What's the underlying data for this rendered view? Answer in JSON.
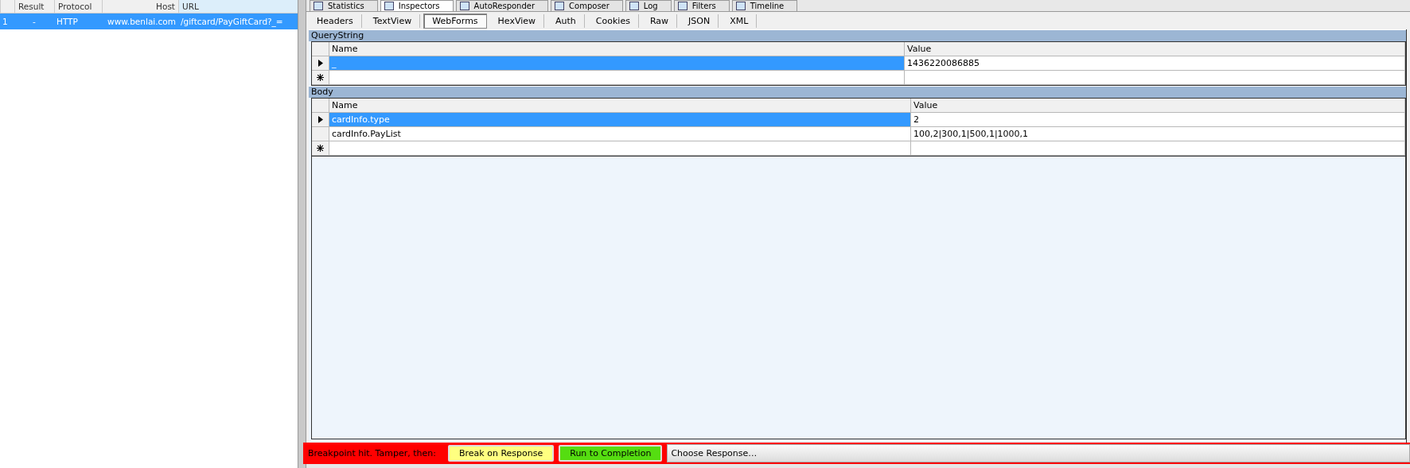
{
  "session_list": {
    "columns": [
      "Result",
      "Protocol",
      "Host",
      "URL"
    ],
    "rows": [
      {
        "number": "1",
        "result": "-",
        "protocol": "HTTP",
        "host": "www.benlai.com",
        "url": "/giftcard/PayGiftCard?_=",
        "selected": true
      }
    ]
  },
  "main_tabs": [
    {
      "label": "Statistics",
      "selected": false
    },
    {
      "label": "Inspectors",
      "selected": true
    },
    {
      "label": "AutoResponder",
      "selected": false
    },
    {
      "label": "Composer",
      "selected": false
    },
    {
      "label": "Log",
      "selected": false
    },
    {
      "label": "Filters",
      "selected": false
    },
    {
      "label": "Timeline",
      "selected": false
    }
  ],
  "inspector_tabs": [
    {
      "label": "Headers",
      "selected": false
    },
    {
      "label": "TextView",
      "selected": false
    },
    {
      "label": "WebForms",
      "selected": true
    },
    {
      "label": "HexView",
      "selected": false
    },
    {
      "label": "Auth",
      "selected": false
    },
    {
      "label": "Cookies",
      "selected": false
    },
    {
      "label": "Raw",
      "selected": false
    },
    {
      "label": "JSON",
      "selected": false
    },
    {
      "label": "XML",
      "selected": false
    }
  ],
  "query_string": {
    "title": "QueryString",
    "columns": [
      "Name",
      "Value"
    ],
    "rows": [
      {
        "name": "_",
        "value": "1436220086885",
        "selected": true
      }
    ]
  },
  "body": {
    "title": "Body",
    "columns": [
      "Name",
      "Value"
    ],
    "rows": [
      {
        "name": "cardInfo.type",
        "value": "2",
        "selected": true
      },
      {
        "name": "cardInfo.PayList",
        "value": "100,2|300,1|500,1|1000,1",
        "selected": false
      }
    ]
  },
  "breakpoint_bar": {
    "message": "Breakpoint hit. Tamper, then:",
    "buttons": [
      {
        "label": "Break on Response",
        "color": "#ffff80"
      },
      {
        "label": "Run to Completion",
        "color": "#55dd11"
      }
    ],
    "response_dropdown": "Choose Response…"
  }
}
